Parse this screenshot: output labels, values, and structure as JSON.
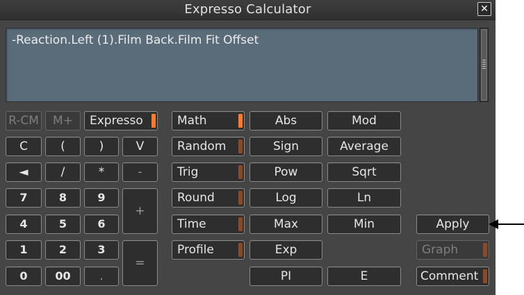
{
  "window": {
    "title": "Expresso Calculator",
    "close_label": "✕"
  },
  "expression": {
    "text": "-Reaction.Left (1).Film Back.Film Fit Offset"
  },
  "keypad": {
    "rcm": "R-CM",
    "mplus": "M+",
    "expresso": "Expresso",
    "clear": "C",
    "lparen": "(",
    "rparen": ")",
    "v": "V",
    "backspace": "◄",
    "div": "/",
    "mul": "*",
    "minus": "-",
    "n7": "7",
    "n8": "8",
    "n9": "9",
    "plus": "+",
    "n4": "4",
    "n5": "5",
    "n6": "6",
    "n1": "1",
    "n2": "2",
    "n3": "3",
    "equals": "=",
    "n0": "0",
    "n00": "00",
    "dot": "."
  },
  "categories": {
    "math": "Math",
    "random": "Random",
    "trig": "Trig",
    "round": "Round",
    "time": "Time",
    "profile": "Profile"
  },
  "functions": {
    "abs": "Abs",
    "mod": "Mod",
    "sign": "Sign",
    "average": "Average",
    "pow": "Pow",
    "sqrt": "Sqrt",
    "log": "Log",
    "ln": "Ln",
    "max": "Max",
    "min": "Min",
    "exp": "Exp",
    "pi": "PI",
    "e": "E"
  },
  "actions": {
    "apply": "Apply",
    "graph": "Graph",
    "comment": "Comment"
  },
  "colors": {
    "expression_bg": "#5a6b7a",
    "tab_active": "#ff7a2a",
    "tab_inactive": "#8a4a25"
  }
}
